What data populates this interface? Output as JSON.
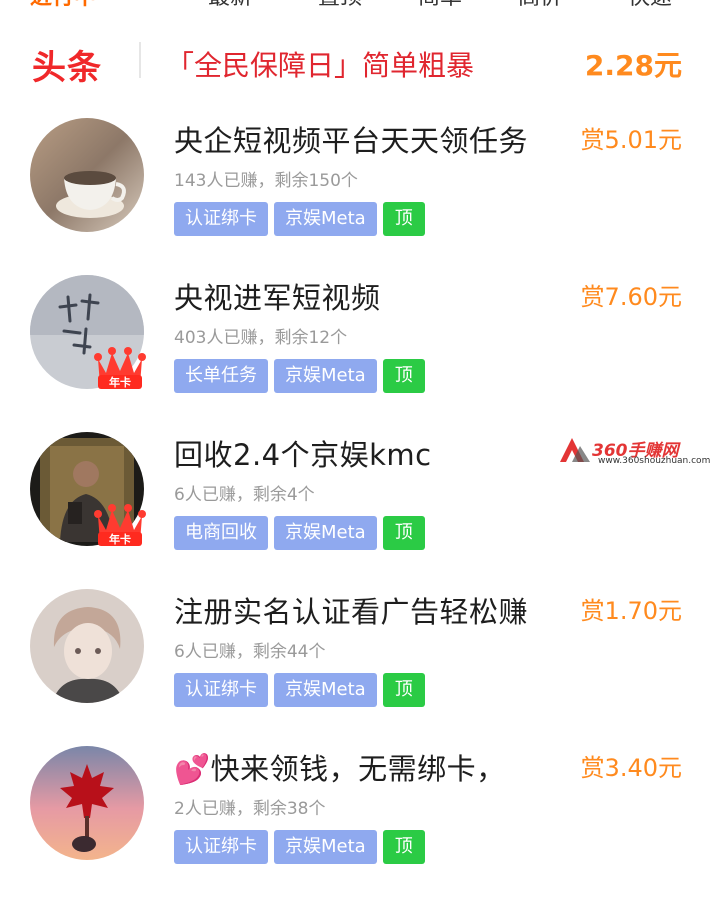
{
  "top_tabs": [
    "进行中",
    "最新",
    "置顶",
    "简单",
    "高价",
    "快速"
  ],
  "headline": {
    "tag": "头条",
    "text": "「全民保障日」简单粗暴",
    "amount": "2.28元"
  },
  "tasks": [
    {
      "title": "央企短视频平台天天领任务",
      "reward": "赏5.01元",
      "stats": "143人已赚，剩余150个",
      "tags": [
        "认证绑卡",
        "京娱Meta",
        "顶"
      ],
      "avatar_badge": ""
    },
    {
      "title": "央视进军短视频",
      "reward": "赏7.60元",
      "stats": "403人已赚，剩余12个",
      "tags": [
        "长单任务",
        "京娱Meta",
        "顶"
      ],
      "avatar_badge": "年卡"
    },
    {
      "title": "回收2.4个京娱kmc",
      "reward": "",
      "stats": "6人已赚，剩余4个",
      "tags": [
        "电商回收",
        "京娱Meta",
        "顶"
      ],
      "avatar_badge": "年卡"
    },
    {
      "title": "注册实名认证看广告轻松赚",
      "reward": "赏1.70元",
      "stats": "6人已赚，剩余44个",
      "tags": [
        "认证绑卡",
        "京娱Meta",
        "顶"
      ],
      "avatar_badge": ""
    },
    {
      "title": "快来领钱，无需绑卡，",
      "reward": "赏3.40元",
      "stats": "2人已赚，剩余38个",
      "tags": [
        "认证绑卡",
        "京娱Meta",
        "顶"
      ],
      "avatar_badge": ""
    }
  ],
  "watermark": {
    "title": "360手赚网",
    "url": "www.360shouzhuan.com"
  },
  "colors": {
    "headline_red": "#f0282a",
    "reward_orange": "#ff8a1e",
    "tag_blue": "#8fa9ef",
    "tag_green": "#2bcb45"
  }
}
